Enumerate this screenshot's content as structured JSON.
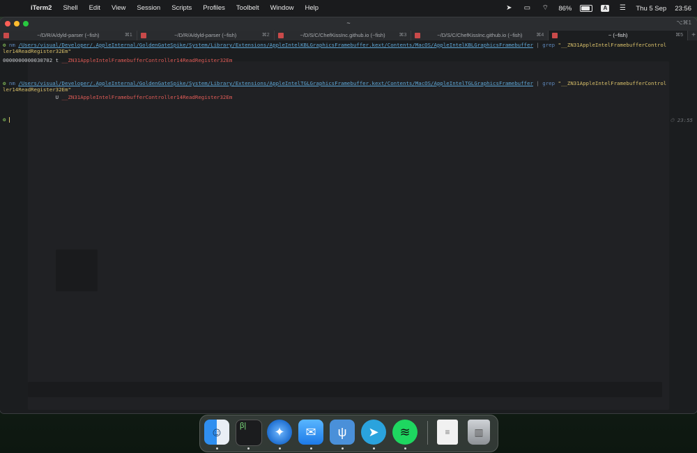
{
  "menubar": {
    "apple_icon": "apple-icon",
    "app_name": "iTerm2",
    "items": [
      "Shell",
      "Edit",
      "View",
      "Session",
      "Scripts",
      "Profiles",
      "Toolbelt",
      "Window",
      "Help"
    ],
    "battery": "86%",
    "battery_level": 0.86,
    "input_source": "A",
    "date": "Thu 5 Sep",
    "time": "23:56"
  },
  "window": {
    "title": "~",
    "shortcut": "⌥⌘1",
    "tabs": [
      {
        "label": "~/D/R/A/dyld-parser (~fish)",
        "key": "⌘1"
      },
      {
        "label": "~/D/R/A/dyld-parser (~fish)",
        "key": "⌘2"
      },
      {
        "label": "~/D/S/C/ChefKissInc.github.io (~fish)",
        "key": "⌘3"
      },
      {
        "label": "~/D/S/C/ChefKissInc.github.io (~fish)",
        "key": "⌘4"
      },
      {
        "label": "~ (~fish)",
        "key": "⌘5"
      }
    ],
    "new_tab": "+"
  },
  "terminal": {
    "cmd1": {
      "prompt": "⚙",
      "nm": "nm",
      "path": "/Users/visual/Developer/.AppleInternal/GoldenGateSpike/System/Library/Extensions/AppleIntelKBLGraphicsFramebuffer.kext/Contents/MacOS/AppleIntelKBLGraphicsFramebuffer",
      "pipe": "|",
      "grep": "grep",
      "arg_start": "\"__ZN31AppleIntelFramebufferControl",
      "arg_end": "ler14ReadRegister32Em\"",
      "out_addr": "0000000000030702 t ",
      "out_sym": "__ZN31AppleIntelFramebufferController14ReadRegister32Em"
    },
    "cmd2": {
      "prompt": "⚙",
      "nm": "nm",
      "path": "/Users/visual/Developer/.AppleInternal/GoldenGateSpike/System/Library/Extensions/AppleIntelTGLGraphicsFramebuffer.kext/Contents/MacOS/AppleIntelTGLGraphicsFramebuffer",
      "pipe": "|",
      "grep": "grep",
      "arg_start": "\"__ZN31AppleIntelFramebufferControl",
      "arg_end": "ler14ReadRegister32Em\"",
      "out_addr": "                 U ",
      "out_sym": "__ZN31AppleIntelFramebufferController14ReadRegister32Em"
    },
    "prompt3": "⚙",
    "right_prompt": "⏱ 23:55"
  },
  "dock": [
    {
      "name": "finder-icon",
      "active": true
    },
    {
      "name": "terminal-icon",
      "active": true
    },
    {
      "name": "safari-icon",
      "active": true
    },
    {
      "name": "mail-icon",
      "active": true
    },
    {
      "name": "fork-icon",
      "active": true
    },
    {
      "name": "telegram-icon",
      "active": true
    },
    {
      "name": "spotify-icon",
      "active": true
    },
    {
      "name": "document-icon",
      "active": false
    },
    {
      "name": "trash-icon",
      "active": false
    }
  ]
}
